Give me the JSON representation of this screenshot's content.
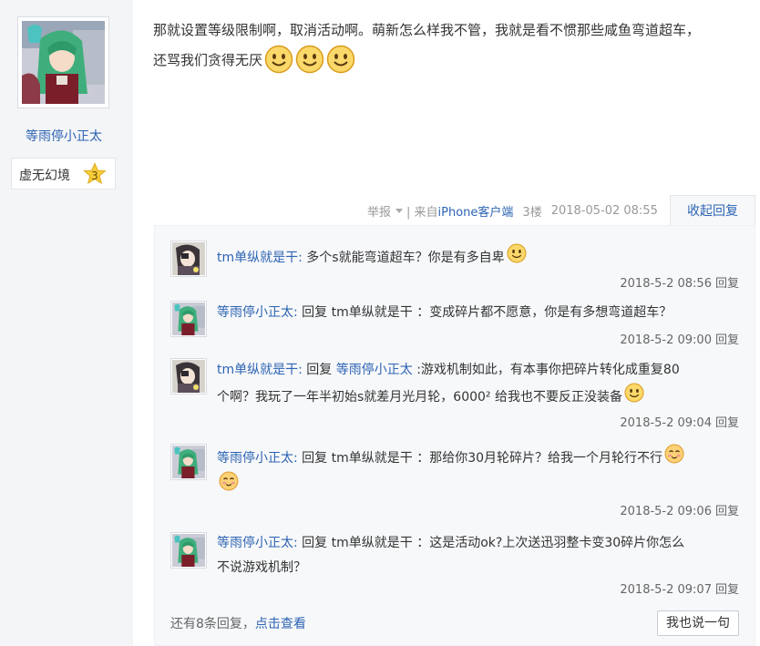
{
  "author": {
    "name": "等雨停小正太",
    "level_name": "虚无幻境",
    "level_num": "3",
    "avatar_icon": "anime-avatar-green-hair"
  },
  "post": {
    "line1": "那就设置等级限制啊，取消活动啊。萌新怎么样我不管，我就是看不惯那些咸鱼弯道超车，",
    "line2": "还骂我们贪得无厌",
    "emoji_icon": "smiley-face-icon",
    "tail": {
      "report": "举报",
      "from_prefix": " | 来自",
      "client": "iPhone客户端",
      "floor": "3楼",
      "time": "2018-05-02 08:55",
      "collapse": "收起回复"
    }
  },
  "replies": [
    {
      "user": "tm单纵就是干:",
      "text": " 多个s就能弯道超车？你是有多自卑",
      "time": "2018-5-2 08:56",
      "reply_label": "回复",
      "avatar_icon": "anime-avatar-dark"
    },
    {
      "user": "等雨停小正太:",
      "prefix": " 回复 ",
      "target": "tm单纵就是干",
      "text": " ：变成碎片都不愿意，你是有多想弯道超车？",
      "time": "2018-5-2 09:00",
      "reply_label": "回复",
      "avatar_icon": "anime-avatar-green-hair"
    },
    {
      "user": "tm单纵就是干:",
      "prefix": " 回复 ",
      "target_link": "等雨停小正太",
      "text1": " :游戏机制如此，有本事你把碎片转化成重复80",
      "text2": "个啊？我玩了一年半初始s就差月光月轮，6000² 给我也不要反正没装备",
      "time": "2018-5-2 09:04",
      "reply_label": "回复",
      "avatar_icon": "anime-avatar-dark"
    },
    {
      "user": "等雨停小正太:",
      "prefix": " 回复 ",
      "target": "tm单纵就是干",
      "text": " ：那给你30月轮碎片？给我一个月轮行不行",
      "time": "2018-5-2 09:06",
      "reply_label": "回复",
      "avatar_icon": "anime-avatar-green-hair"
    },
    {
      "user": "等雨停小正太:",
      "prefix": " 回复 ",
      "target": "tm单纵就是干",
      "text1": " ：这是活动ok?上次送迅羽整卡变30碎片你怎么",
      "text2": "不说游戏机制？",
      "time": "2018-5-2 09:07",
      "reply_label": "回复",
      "avatar_icon": "anime-avatar-green-hair"
    }
  ],
  "footer": {
    "more_prefix": "还有8条回复，",
    "more_link": "点击查看",
    "say_button": "我也说一句"
  },
  "colors": {
    "link": "#2d64b3",
    "side_bg": "#f4f5f7",
    "reply_bg": "#f7f8fa"
  }
}
